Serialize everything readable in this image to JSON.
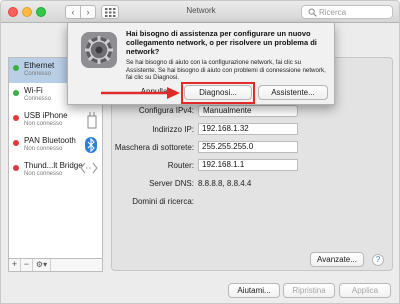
{
  "window": {
    "title": "Network",
    "search_placeholder": "Ricerca"
  },
  "sidebar": {
    "items": [
      {
        "name": "Ethernet",
        "status": "Connesso",
        "dot_color": "#3cb043",
        "selected": true
      },
      {
        "name": "Wi-Fi",
        "status": "Connesso",
        "dot_color": "#3cb043"
      },
      {
        "name": "USB iPhone",
        "status": "Non connesso",
        "dot_color": "#e0393e"
      },
      {
        "name": "PAN Bluetooth",
        "status": "Non connesso",
        "dot_color": "#e0393e"
      },
      {
        "name": "Thund...lt Bridge",
        "status": "Non connesso",
        "dot_color": "#e0393e"
      }
    ],
    "add": "+",
    "remove": "−",
    "action": "⚙▾"
  },
  "main": {
    "configure_label": "Configura IPv4:",
    "configure_value": "Manualmente",
    "ip_label": "Indirizzo IP:",
    "ip_value": "192.168.1.32",
    "mask_label": "Maschera di sottorete:",
    "mask_value": "255.255.255.0",
    "router_label": "Router:",
    "router_value": "192.168.1.1",
    "dns_label": "Server DNS:",
    "dns_value": "8.8.8.8, 8.8.4.4",
    "domains_label": "Domini di ricerca:",
    "advanced": "Avanzate...",
    "help": "?"
  },
  "bottom": {
    "assist": "Aiutami...",
    "revert": "Ripristina",
    "apply": "Applica"
  },
  "dialog": {
    "title": "Hai bisogno di assistenza per configurare un nuovo collegamento network, o per risolvere un problema di network?",
    "body": "Se hai bisogno di aiuto con la configurazione network, fai clic su Assistente. Se hai bisogno di aiuto con problemi di connessione network, fai clic su Diagnosi.",
    "cancel": "Annulla",
    "diagnose": "Diagnosi...",
    "assistant": "Assistente...",
    "highlight_color": "#e02b2b"
  }
}
